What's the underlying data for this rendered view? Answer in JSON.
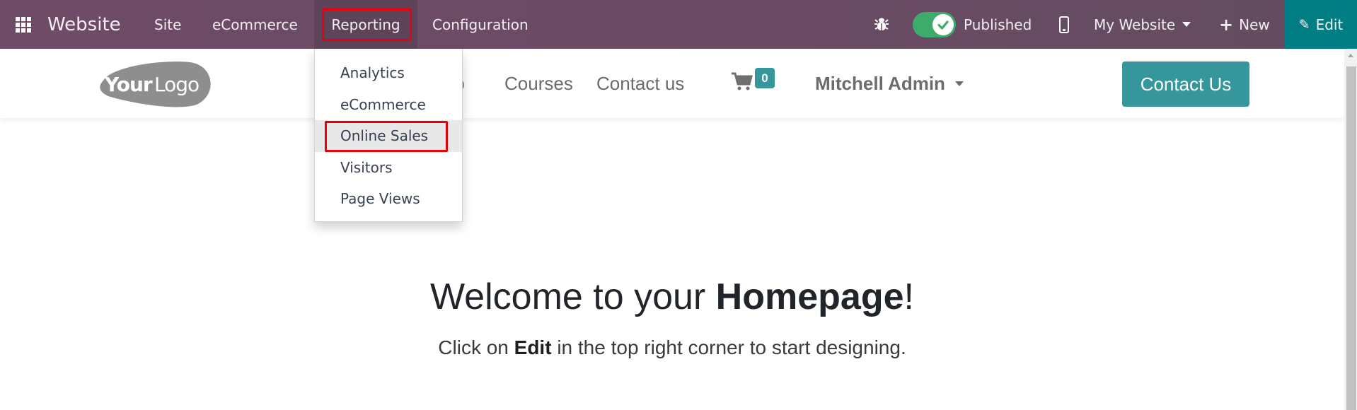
{
  "topbar": {
    "app_icon": "apps-grid-icon",
    "brand": "Website",
    "menu": [
      {
        "label": "Site"
      },
      {
        "label": "eCommerce"
      },
      {
        "label": "Reporting",
        "active": true,
        "highlighted": true
      },
      {
        "label": "Configuration"
      }
    ],
    "debug_icon": "bug-icon",
    "published_toggle": {
      "label": "Published",
      "on": true
    },
    "device_icon": "mobile-phone-icon",
    "website_selector": "My Website",
    "new_button": "New",
    "edit_button": "Edit",
    "colors": {
      "navbar": "#6b4c65",
      "edit": "#017e84",
      "toggle": "#3dab69",
      "highlight": "#e8000b"
    }
  },
  "reporting_dropdown": {
    "items": [
      {
        "label": "Analytics"
      },
      {
        "label": "eCommerce"
      },
      {
        "label": "Online Sales",
        "hovered": true,
        "highlighted": true
      },
      {
        "label": "Visitors"
      },
      {
        "label": "Page Views"
      }
    ]
  },
  "site_header": {
    "logo_text_bold": "Your",
    "logo_text_light": "Logo",
    "nav": [
      {
        "label": "Shop",
        "visible_text": "op"
      },
      {
        "label": "Courses"
      },
      {
        "label": "Contact us"
      }
    ],
    "cart_count": "0",
    "user": "Mitchell Admin",
    "cta": "Contact Us",
    "colors": {
      "accent": "#35969b"
    }
  },
  "hero": {
    "title_pre": "Welcome to your ",
    "title_bold": "Homepage",
    "title_post": "!",
    "sub_pre": "Click on ",
    "sub_bold": "Edit",
    "sub_post": " in the top right corner to start designing."
  }
}
